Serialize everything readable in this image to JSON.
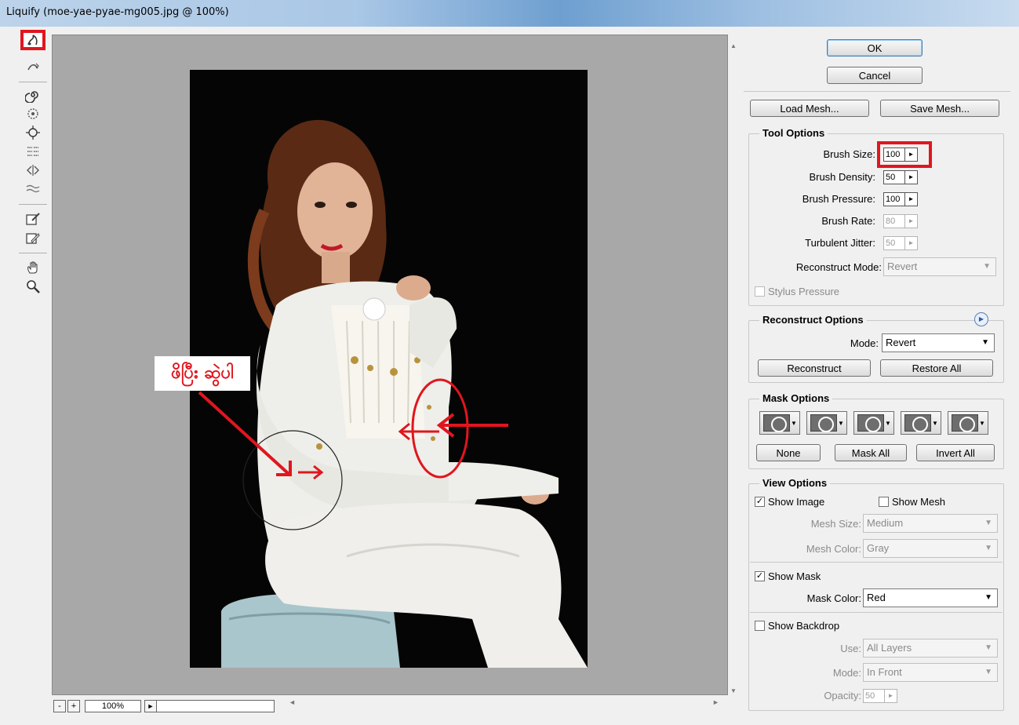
{
  "window": {
    "title": "Liquify (moe-yae-pyae-mg005.jpg @ 100%)"
  },
  "tools": [
    {
      "name": "forward-warp-tool-icon",
      "active": true
    },
    {
      "name": "reconstruct-tool-icon"
    },
    {
      "name": "twirl-clockwise-tool-icon"
    },
    {
      "name": "pucker-tool-icon"
    },
    {
      "name": "bloat-tool-icon"
    },
    {
      "name": "push-left-tool-icon"
    },
    {
      "name": "mirror-tool-icon"
    },
    {
      "name": "turbulence-tool-icon"
    },
    {
      "name": "freeze-mask-tool-icon"
    },
    {
      "name": "thaw-mask-tool-icon"
    },
    {
      "name": "hand-tool-icon"
    },
    {
      "name": "zoom-tool-icon"
    }
  ],
  "canvas": {
    "annotation_text": "ဖိပြီး ဆွဲပါ",
    "zoom": {
      "minus": "-",
      "plus": "+",
      "value": "100%",
      "menu_arrow": "►"
    }
  },
  "panel": {
    "ok": "OK",
    "cancel": "Cancel",
    "load_mesh": "Load Mesh...",
    "save_mesh": "Save Mesh...",
    "tool_options": {
      "title": "Tool Options",
      "brush_size": {
        "label": "Brush Size:",
        "value": "100"
      },
      "brush_density": {
        "label": "Brush Density:",
        "value": "50"
      },
      "brush_pressure": {
        "label": "Brush Pressure:",
        "value": "100"
      },
      "brush_rate": {
        "label": "Brush Rate:",
        "value": "80"
      },
      "turbulent_jitter": {
        "label": "Turbulent Jitter:",
        "value": "50"
      },
      "reconstruct_mode": {
        "label": "Reconstruct Mode:",
        "value": "Revert"
      },
      "stylus_pressure": "Stylus Pressure"
    },
    "reconstruct_options": {
      "title": "Reconstruct Options",
      "mode_label": "Mode:",
      "mode_value": "Revert",
      "reconstruct": "Reconstruct",
      "restore_all": "Restore All"
    },
    "mask_options": {
      "title": "Mask Options",
      "buttons": [
        "replace-selection",
        "add-to-selection",
        "subtract-from-selection",
        "intersect-with-selection",
        "invert-selection"
      ],
      "none": "None",
      "mask_all": "Mask All",
      "invert_all": "Invert All"
    },
    "view_options": {
      "title": "View Options",
      "show_image": "Show Image",
      "show_image_checked": true,
      "show_mesh": "Show Mesh",
      "show_mesh_checked": false,
      "mesh_size": {
        "label": "Mesh Size:",
        "value": "Medium"
      },
      "mesh_color": {
        "label": "Mesh Color:",
        "value": "Gray"
      },
      "show_mask": "Show Mask",
      "show_mask_checked": true,
      "mask_color": {
        "label": "Mask Color:",
        "value": "Red"
      },
      "show_backdrop": "Show Backdrop",
      "show_backdrop_checked": false,
      "use": {
        "label": "Use:",
        "value": "All Layers"
      },
      "mode": {
        "label": "Mode:",
        "value": "In Front"
      },
      "opacity": {
        "label": "Opacity:",
        "value": "50"
      }
    }
  },
  "colors": {
    "highlight": "#e0161e",
    "canvas_bg": "#a8a8a8",
    "panel_bg": "#f0f0f0"
  }
}
